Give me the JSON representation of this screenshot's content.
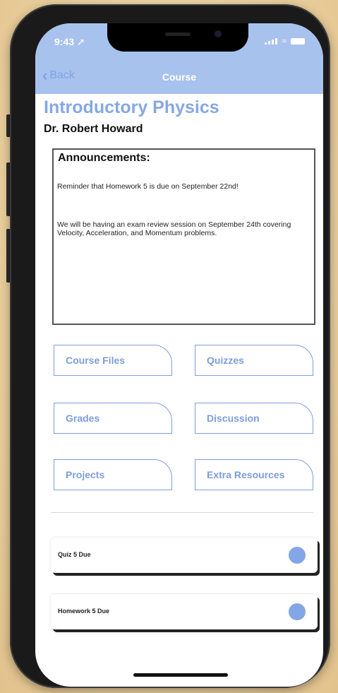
{
  "status": {
    "time": "9:43 ➚"
  },
  "nav": {
    "back_label": "Back",
    "title": "Course"
  },
  "course": {
    "title": "Introductory Physics",
    "instructor": "Dr. Robert Howard"
  },
  "announcements": {
    "title": "Announcements:",
    "items": [
      "Reminder that Homework 5 is due on September 22nd!",
      "We will be having an exam review session on September 24th covering Velocity, Acceleration, and Momentum problems."
    ]
  },
  "tiles": [
    "Course Files",
    "Quizzes",
    "Grades",
    "Discussion",
    "Projects",
    "Extra Resources"
  ],
  "due_items": [
    {
      "label": "Quiz 5 Due"
    },
    {
      "label": "Homework 5 Due"
    }
  ],
  "colors": {
    "accent": "#a8c2ee",
    "tile_text": "#7d9ddb",
    "dot": "#83a6e6"
  }
}
